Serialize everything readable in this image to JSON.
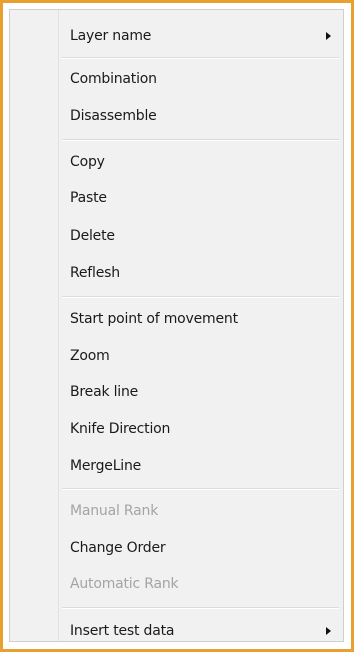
{
  "context_menu": {
    "group_layer": {
      "layer_name": "Layer name"
    },
    "group_combine": {
      "combination": "Combination",
      "disassemble": "Disassemble"
    },
    "group_edit": {
      "copy": "Copy",
      "paste": "Paste",
      "delete": "Delete",
      "reflesh": "Reflesh"
    },
    "group_line": {
      "start_point": "Start point of movement",
      "zoom": "Zoom",
      "break_line": "Break line",
      "knife_direction": "Knife Direction",
      "merge_line": "MergeLine"
    },
    "group_rank": {
      "manual_rank": "Manual Rank",
      "change_order": "Change Order",
      "automatic_rank": "Automatic Rank"
    },
    "group_test": {
      "insert_test_data": "Insert test data"
    }
  },
  "icons": {
    "submenu_arrow": "chevron-right-icon"
  },
  "colors": {
    "frame_border": "#e8a030",
    "menu_background": "#f1f1f1",
    "text": "#1a1a1a",
    "disabled_text": "#a4a4a4"
  }
}
